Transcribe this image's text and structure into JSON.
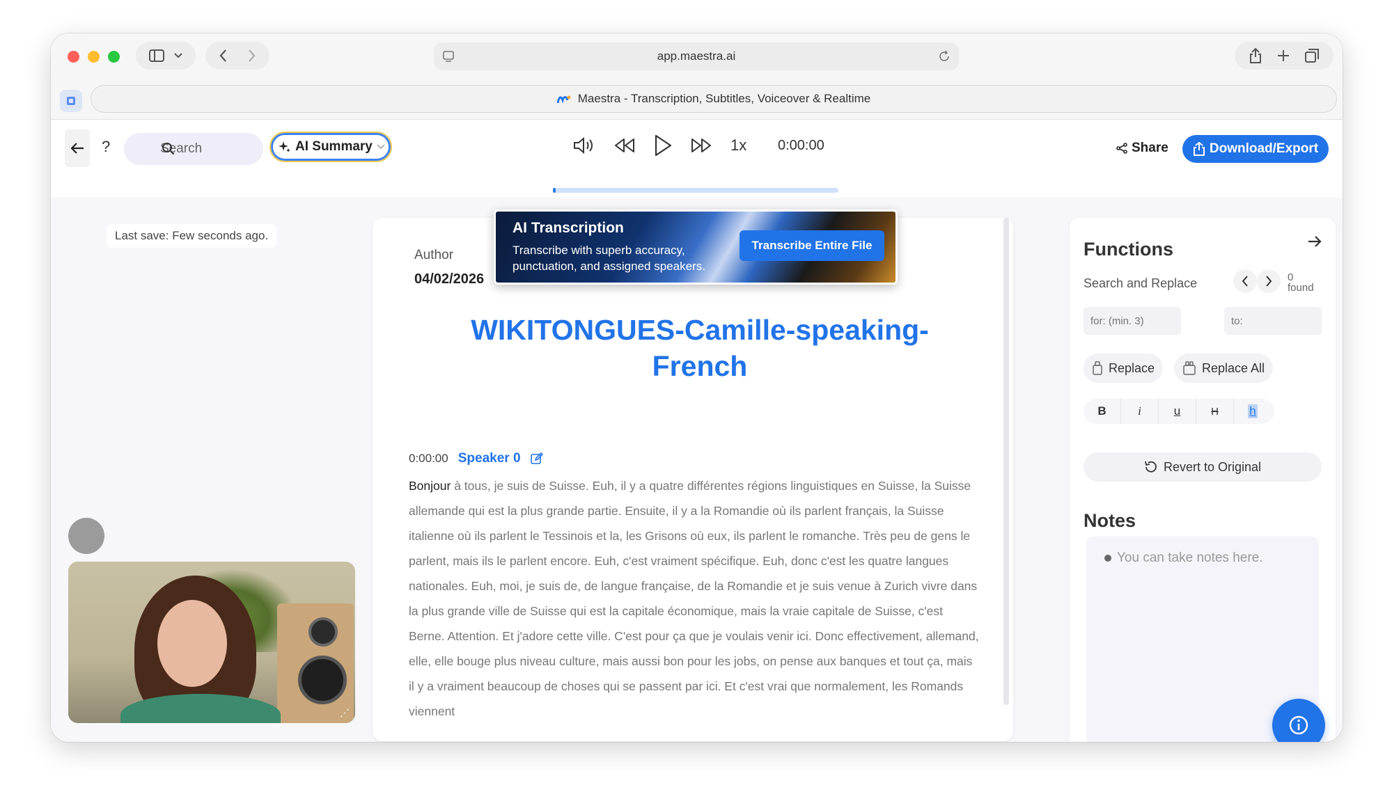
{
  "browser": {
    "url": "app.maestra.ai",
    "tab_title": "Maestra - Transcription, Subtitles, Voiceover & Realtime"
  },
  "header": {
    "help": "?",
    "search_label": "Search",
    "ai_summary_label": "AI Summary",
    "speed": "1x",
    "time": "0:00:00",
    "share_label": "Share",
    "download_label": "Download/Export",
    "progress": 0
  },
  "left": {
    "last_save": "Last save: Few seconds ago."
  },
  "banner": {
    "title": "AI Transcription",
    "text": "Transcribe with superb accuracy, punctuation, and assigned speakers.",
    "cta": "Transcribe Entire File"
  },
  "document": {
    "author_label": "Author",
    "date": "04/02/2026",
    "title": "WIKITONGUES-Camille-speaking-French",
    "segment": {
      "timestamp": "0:00:00",
      "speaker": "Speaker 0",
      "first_word": "Bonjour",
      "text": " à tous, je suis de Suisse. Euh, il y a quatre différentes régions linguistiques en Suisse, la Suisse allemande qui est la plus grande partie. Ensuite, il y a la Romandie où ils parlent français, la Suisse italienne où ils parlent le Tessinois et la, les Grisons où eux, ils parlent le romanche. Très peu de gens le parlent, mais ils le parlent encore. Euh, c'est vraiment spécifique. Euh, donc c'est les quatre langues nationales. Euh, moi, je suis de, de langue française, de la Romandie et je suis venue à Zurich vivre dans la plus grande ville de Suisse qui est la capitale économique, mais la vraie capitale de Suisse, c'est Berne. Attention. Et j'adore cette ville. C'est pour ça que je voulais venir ici. Donc effectivement, allemand, elle, elle bouge plus niveau culture, mais aussi bon pour les jobs, on pense aux banques et tout ça, mais il y a vraiment beaucoup de choses qui se passent par ici. Et c'est vrai que normalement, les Romands viennent"
    }
  },
  "functions": {
    "title": "Functions",
    "search_replace_label": "Search and Replace",
    "found_count": "0",
    "found_label": "found",
    "for_placeholder": "for: (min. 3)",
    "to_placeholder": "to:",
    "replace_label": "Replace",
    "replace_all_label": "Replace All",
    "format": {
      "bold": "B",
      "italic": "i",
      "underline": "u",
      "strike": "H",
      "highlight": "h"
    },
    "revert_label": "Revert to Original",
    "notes_title": "Notes",
    "notes_placeholder": "You can take notes here."
  },
  "colors": {
    "accent": "#2173e8",
    "traffic_red": "#ff5f57",
    "traffic_yellow": "#febc2e",
    "traffic_green": "#28c840"
  }
}
